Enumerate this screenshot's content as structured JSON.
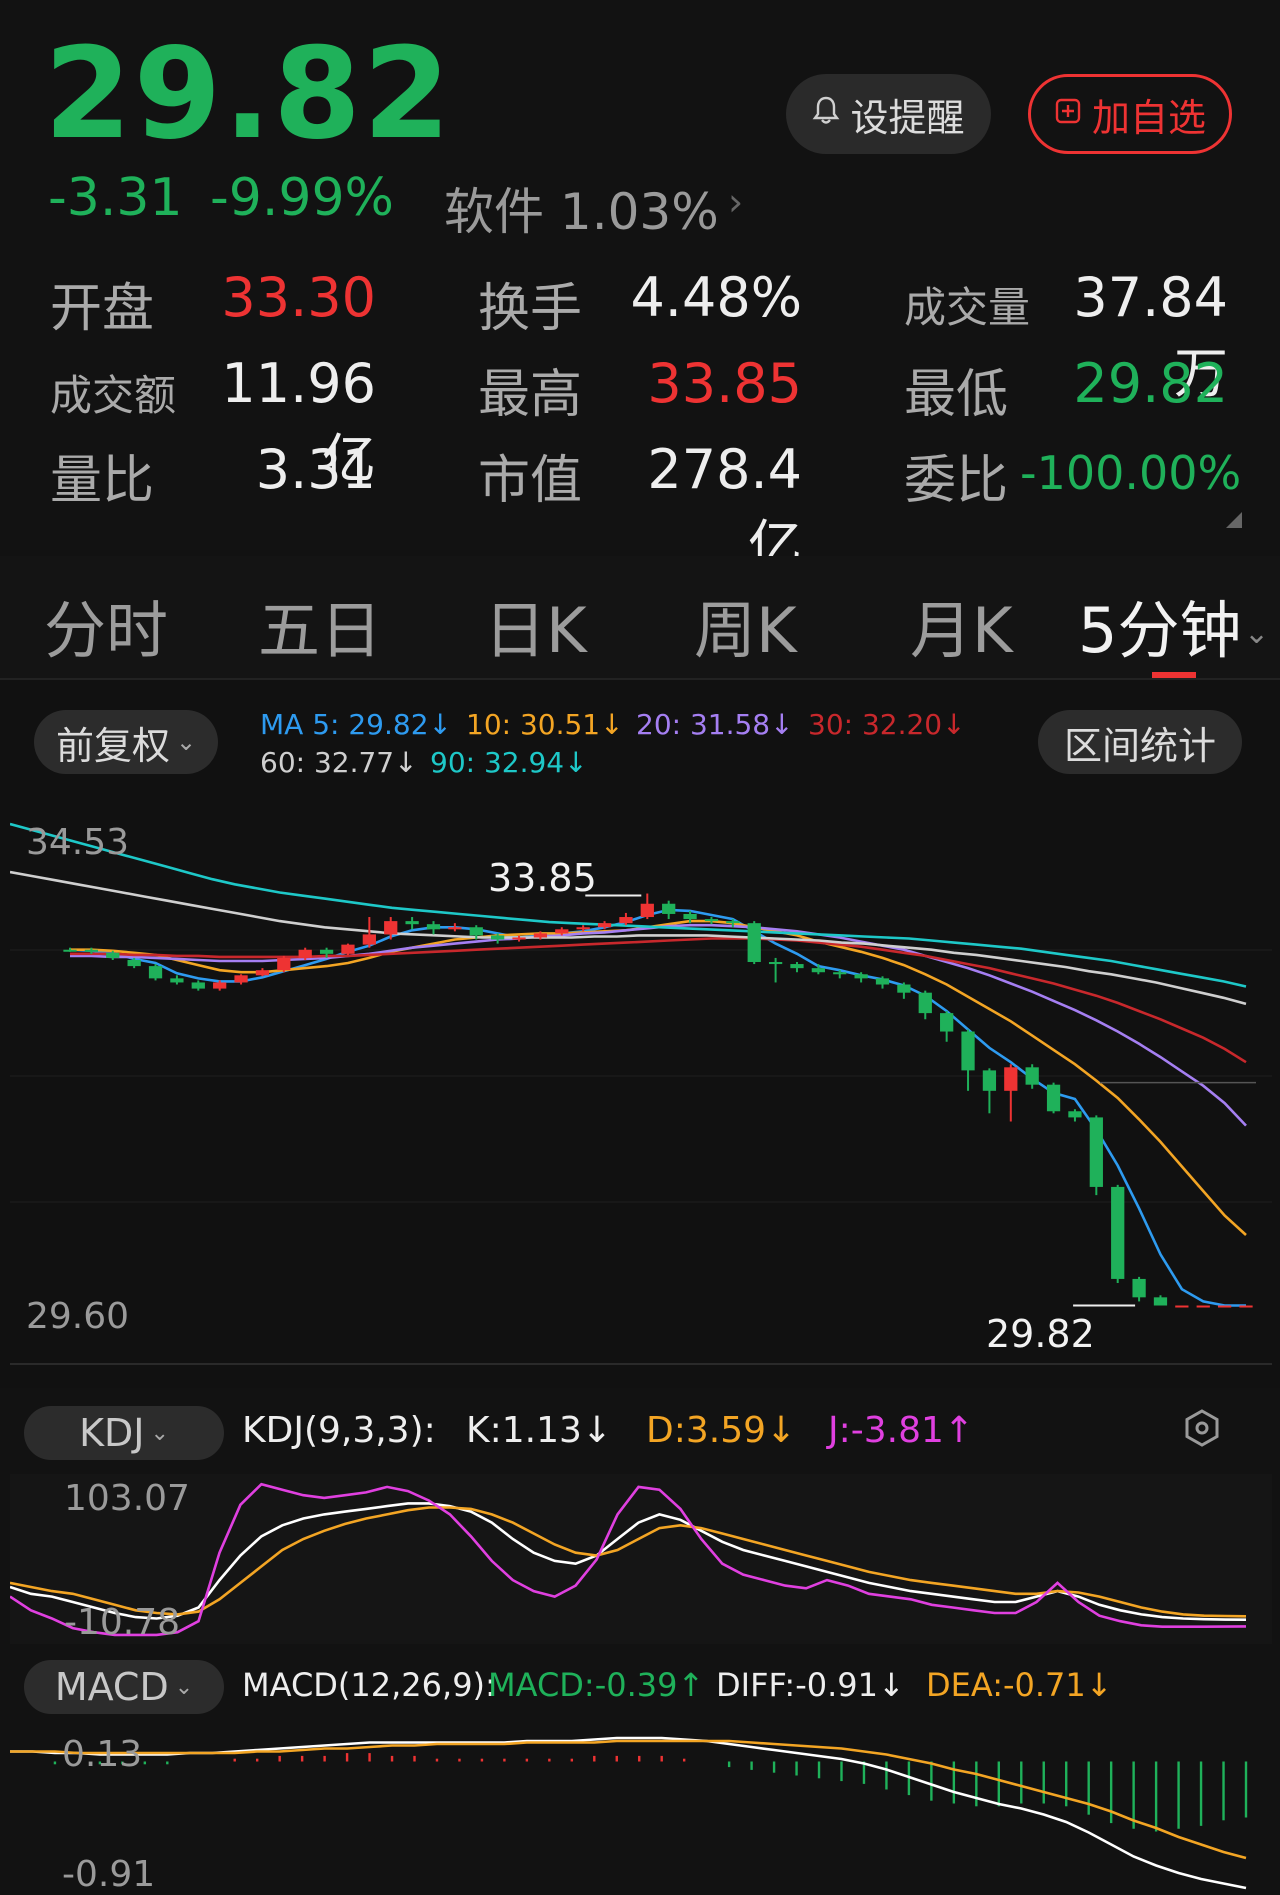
{
  "quote": {
    "price": "29.82",
    "change": "-3.31",
    "change_pct": "-9.99%",
    "sector": "软件 1.03%",
    "alert_label": "设提醒",
    "fav_label": "加自选",
    "stats": {
      "open_label": "开盘",
      "open": "33.30",
      "turnover_label": "换手",
      "turnover": "4.48%",
      "volume_label": "成交量",
      "volume": "37.84万",
      "amount_label": "成交额",
      "amount": "11.96亿",
      "high_label": "最高",
      "high": "33.85",
      "low_label": "最低",
      "low": "29.82",
      "vol_ratio_label": "量比",
      "vol_ratio": "3.31",
      "mcap_label": "市值",
      "mcap": "278.4亿",
      "bid_ratio_label": "委比",
      "bid_ratio": "-100.00%"
    },
    "colors": {
      "up": "#ee3333",
      "down": "#1fb15a"
    }
  },
  "tabs": [
    "分时",
    "五日",
    "日K",
    "周K",
    "月K",
    "5分钟"
  ],
  "active_tab": "5分钟",
  "chart": {
    "adjust_label": "前复权",
    "range_stats_label": "区间统计",
    "ma": {
      "ma5": "MA 5: 29.82↓",
      "ma10": "10: 30.51↓",
      "ma20": "20: 31.58↓",
      "ma30": "30: 32.20↓",
      "ma60": "60: 32.77↓",
      "ma90": "90: 32.94↓"
    },
    "axis_high": "34.53",
    "axis_low": "29.60",
    "max_label": "33.85",
    "min_label": "29.82"
  },
  "kdj": {
    "label": "KDJ",
    "params": "KDJ(9,3,3):",
    "k": "K:1.13↓",
    "d": "D:3.59↓",
    "j": "J:-3.81↑",
    "axis_high": "103.07",
    "axis_low": "-10.78"
  },
  "macd": {
    "label": "MACD",
    "params": "MACD(12,26,9):",
    "macd": "MACD:-0.39↑",
    "diff": "DIFF:-0.91↓",
    "dea": "DEA:-0.71↓",
    "axis_high": "0.13",
    "axis_low": "-0.91"
  },
  "chart_data": [
    {
      "type": "candlestick",
      "title": "5分钟",
      "ylim": [
        29.6,
        34.53
      ],
      "candles": [
        [
          33.3,
          33.3,
          33.32,
          33.28
        ],
        [
          33.3,
          33.28,
          33.32,
          33.26
        ],
        [
          33.27,
          33.22,
          33.29,
          33.2
        ],
        [
          33.2,
          33.14,
          33.22,
          33.12
        ],
        [
          33.14,
          33.02,
          33.16,
          33.0
        ],
        [
          33.02,
          32.98,
          33.05,
          32.96
        ],
        [
          32.98,
          32.92,
          33.0,
          32.9
        ],
        [
          32.92,
          32.98,
          33.0,
          32.9
        ],
        [
          32.98,
          33.05,
          33.06,
          32.96
        ],
        [
          33.05,
          33.1,
          33.12,
          33.04
        ],
        [
          33.1,
          33.22,
          33.24,
          33.08
        ],
        [
          33.22,
          33.3,
          33.32,
          33.2
        ],
        [
          33.3,
          33.26,
          33.32,
          33.22
        ],
        [
          33.26,
          33.35,
          33.36,
          33.25
        ],
        [
          33.35,
          33.45,
          33.62,
          33.32
        ],
        [
          33.45,
          33.58,
          33.62,
          33.4
        ],
        [
          33.58,
          33.55,
          33.62,
          33.5
        ],
        [
          33.55,
          33.5,
          33.58,
          33.45
        ],
        [
          33.5,
          33.52,
          33.56,
          33.48
        ],
        [
          33.52,
          33.44,
          33.54,
          33.4
        ],
        [
          33.44,
          33.4,
          33.46,
          33.36
        ],
        [
          33.4,
          33.42,
          33.44,
          33.38
        ],
        [
          33.42,
          33.46,
          33.48,
          33.4
        ],
        [
          33.46,
          33.5,
          33.52,
          33.44
        ],
        [
          33.5,
          33.52,
          33.54,
          33.48
        ],
        [
          33.52,
          33.56,
          33.58,
          33.5
        ],
        [
          33.56,
          33.62,
          33.66,
          33.54
        ],
        [
          33.62,
          33.75,
          33.85,
          33.6
        ],
        [
          33.75,
          33.65,
          33.78,
          33.6
        ],
        [
          33.65,
          33.6,
          33.68,
          33.56
        ],
        [
          33.6,
          33.58,
          33.62,
          33.55
        ],
        [
          33.58,
          33.56,
          33.6,
          33.52
        ],
        [
          33.56,
          33.18,
          33.58,
          33.16
        ],
        [
          33.18,
          33.16,
          33.22,
          32.98
        ],
        [
          33.16,
          33.12,
          33.18,
          33.08
        ],
        [
          33.12,
          33.08,
          33.16,
          33.06
        ],
        [
          33.08,
          33.06,
          33.1,
          33.02
        ],
        [
          33.06,
          33.02,
          33.08,
          32.98
        ],
        [
          33.02,
          32.96,
          33.04,
          32.92
        ],
        [
          32.96,
          32.88,
          32.98,
          32.82
        ],
        [
          32.88,
          32.68,
          32.9,
          32.62
        ],
        [
          32.68,
          32.5,
          32.7,
          32.4
        ],
        [
          32.5,
          32.12,
          32.52,
          31.92
        ],
        [
          32.12,
          31.92,
          32.14,
          31.7
        ],
        [
          31.92,
          32.15,
          32.18,
          31.62
        ],
        [
          32.15,
          31.98,
          32.18,
          31.94
        ],
        [
          31.98,
          31.72,
          32.0,
          31.7
        ],
        [
          31.72,
          31.66,
          31.74,
          31.62
        ],
        [
          31.66,
          30.98,
          31.68,
          30.9
        ],
        [
          30.98,
          30.08,
          31.0,
          30.04
        ],
        [
          30.08,
          29.9,
          30.1,
          29.86
        ],
        [
          29.9,
          29.82,
          29.92,
          29.82
        ],
        [
          29.82,
          29.82,
          29.82,
          29.82
        ],
        [
          29.82,
          29.82,
          29.82,
          29.82
        ],
        [
          29.82,
          29.82,
          29.82,
          29.82
        ],
        [
          29.82,
          29.82,
          29.82,
          29.82
        ]
      ],
      "candle_format": "[open, close, high, low]",
      "series": [
        {
          "name": "MA 5",
          "color": "#2e9bf0",
          "values": [
            33.3,
            33.29,
            33.27,
            33.21,
            33.17,
            33.07,
            33.02,
            32.99,
            32.99,
            33.03,
            33.09,
            33.15,
            33.21,
            33.28,
            33.34,
            33.43,
            33.49,
            33.52,
            33.52,
            33.5,
            33.46,
            33.42,
            33.44,
            33.46,
            33.48,
            33.52,
            33.57,
            33.64,
            33.69,
            33.68,
            33.64,
            33.6,
            33.48,
            33.36,
            33.26,
            33.14,
            33.1,
            33.05,
            33.01,
            32.95,
            32.85,
            32.7,
            32.52,
            32.34,
            32.2,
            32.04,
            31.9,
            31.84,
            31.54,
            31.19,
            30.77,
            30.32,
            29.98,
            29.86,
            29.82,
            29.82
          ]
        },
        {
          "name": "10",
          "color": "#f3a524",
          "values": [
            33.3,
            33.3,
            33.29,
            33.27,
            33.25,
            33.2,
            33.15,
            33.1,
            33.08,
            33.08,
            33.1,
            33.12,
            33.14,
            33.17,
            33.22,
            33.28,
            33.32,
            33.36,
            33.4,
            33.42,
            33.44,
            33.45,
            33.46,
            33.46,
            33.47,
            33.48,
            33.49,
            33.52,
            33.55,
            33.58,
            33.58,
            33.56,
            33.52,
            33.48,
            33.44,
            33.38,
            33.33,
            33.28,
            33.22,
            33.15,
            33.06,
            32.96,
            32.84,
            32.72,
            32.6,
            32.46,
            32.32,
            32.18,
            32.02,
            31.85,
            31.64,
            31.42,
            31.18,
            30.94,
            30.7,
            30.51
          ]
        },
        {
          "name": "20",
          "color": "#a57ff2",
          "values": [
            33.24,
            33.24,
            33.23,
            33.23,
            33.22,
            33.21,
            33.2,
            33.19,
            33.19,
            33.19,
            33.2,
            33.21,
            33.22,
            33.24,
            33.26,
            33.29,
            33.32,
            33.34,
            33.36,
            33.38,
            33.4,
            33.41,
            33.43,
            33.44,
            33.46,
            33.47,
            33.49,
            33.51,
            33.53,
            33.54,
            33.54,
            33.53,
            33.52,
            33.5,
            33.48,
            33.45,
            33.42,
            33.38,
            33.34,
            33.3,
            33.24,
            33.18,
            33.12,
            33.05,
            32.97,
            32.89,
            32.8,
            32.71,
            32.61,
            32.5,
            32.38,
            32.25,
            32.11,
            31.97,
            31.8,
            31.58
          ]
        },
        {
          "name": "30",
          "color": "#c8282c",
          "values": [
            33.26,
            33.26,
            33.26,
            33.25,
            33.25,
            33.24,
            33.24,
            33.23,
            33.23,
            33.23,
            33.23,
            33.23,
            33.24,
            33.24,
            33.25,
            33.26,
            33.27,
            33.28,
            33.29,
            33.3,
            33.31,
            33.32,
            33.33,
            33.34,
            33.35,
            33.36,
            33.37,
            33.38,
            33.39,
            33.4,
            33.41,
            33.41,
            33.41,
            33.4,
            33.39,
            33.37,
            33.35,
            33.33,
            33.3,
            33.27,
            33.24,
            33.2,
            33.16,
            33.12,
            33.07,
            33.02,
            32.97,
            32.91,
            32.85,
            32.78,
            32.7,
            32.62,
            32.53,
            32.44,
            32.33,
            32.2
          ]
        },
        {
          "name": "60",
          "color": "#cfcfcf",
          "values": [
            34.06,
            34.02,
            33.98,
            33.94,
            33.9,
            33.86,
            33.82,
            33.78,
            33.74,
            33.7,
            33.66,
            33.62,
            33.58,
            33.55,
            33.52,
            33.5,
            33.48,
            33.46,
            33.45,
            33.44,
            33.43,
            33.42,
            33.42,
            33.42,
            33.42,
            33.42,
            33.43,
            33.43,
            33.44,
            33.44,
            33.44,
            33.44,
            33.43,
            33.42,
            33.41,
            33.4,
            33.39,
            33.37,
            33.36,
            33.34,
            33.32,
            33.3,
            33.27,
            33.25,
            33.22,
            33.19,
            33.16,
            33.13,
            33.09,
            33.06,
            33.02,
            32.98,
            32.93,
            32.88,
            32.83,
            32.77
          ]
        },
        {
          "name": "90",
          "color": "#1ec8c8",
          "values": [
            34.53,
            34.47,
            34.41,
            34.35,
            34.29,
            34.23,
            34.17,
            34.11,
            34.05,
            33.99,
            33.94,
            33.9,
            33.86,
            33.83,
            33.8,
            33.77,
            33.74,
            33.71,
            33.69,
            33.67,
            33.65,
            33.63,
            33.61,
            33.59,
            33.57,
            33.56,
            33.55,
            33.54,
            33.53,
            33.52,
            33.51,
            33.5,
            33.49,
            33.48,
            33.47,
            33.46,
            33.45,
            33.44,
            33.43,
            33.42,
            33.41,
            33.39,
            33.37,
            33.35,
            33.33,
            33.31,
            33.28,
            33.25,
            33.22,
            33.19,
            33.15,
            33.11,
            33.07,
            33.03,
            32.99,
            32.94
          ]
        }
      ]
    },
    {
      "type": "line",
      "title": "KDJ(9,3,3)",
      "ylim": [
        -10.78,
        103.07
      ],
      "series": [
        {
          "name": "K",
          "color": "#ffffff",
          "values": [
            25,
            20,
            18,
            14,
            10,
            6,
            3,
            2,
            4,
            10,
            30,
            48,
            62,
            70,
            75,
            78,
            80,
            82,
            84,
            86,
            86,
            84,
            80,
            72,
            60,
            50,
            44,
            42,
            48,
            60,
            72,
            78,
            74,
            66,
            58,
            52,
            48,
            44,
            40,
            36,
            32,
            28,
            25,
            22,
            20,
            18,
            16,
            14,
            14,
            18,
            22,
            18,
            12,
            8,
            5,
            3,
            2,
            1.5,
            1.2,
            1.13
          ]
        },
        {
          "name": "D",
          "color": "#f3a524",
          "values": [
            28,
            25,
            22,
            20,
            16,
            12,
            8,
            6,
            5,
            7,
            16,
            28,
            40,
            52,
            60,
            66,
            71,
            75,
            78,
            81,
            83,
            83,
            82,
            78,
            72,
            64,
            56,
            50,
            48,
            52,
            60,
            68,
            70,
            68,
            64,
            60,
            56,
            52,
            48,
            44,
            40,
            36,
            33,
            30,
            28,
            26,
            24,
            22,
            20,
            20,
            22,
            21,
            18,
            14,
            10,
            7,
            5,
            4,
            3.8,
            3.59
          ]
        },
        {
          "name": "J",
          "color": "#e040e0",
          "values": [
            18,
            8,
            2,
            -5,
            -8,
            -10,
            -10,
            -10,
            -8,
            0,
            50,
            85,
            100,
            96,
            92,
            90,
            92,
            94,
            98,
            95,
            88,
            78,
            62,
            44,
            30,
            22,
            18,
            26,
            45,
            78,
            98,
            96,
            82,
            60,
            42,
            34,
            30,
            26,
            24,
            30,
            26,
            20,
            18,
            16,
            12,
            10,
            8,
            6,
            6,
            14,
            28,
            14,
            4,
            0,
            -3,
            -4,
            -4,
            -4,
            -3.9,
            -3.81
          ]
        }
      ]
    },
    {
      "type": "bar",
      "title": "MACD(12,26,9)",
      "ylim": [
        -0.91,
        0.13
      ],
      "series": [
        {
          "name": "DIFF",
          "color": "#ffffff",
          "values": [
            0.0,
            0.0,
            -0.01,
            -0.01,
            -0.02,
            -0.02,
            -0.02,
            -0.02,
            -0.01,
            -0.01,
            0.0,
            0.01,
            0.02,
            0.03,
            0.04,
            0.05,
            0.06,
            0.06,
            0.06,
            0.06,
            0.06,
            0.06,
            0.06,
            0.07,
            0.07,
            0.07,
            0.08,
            0.09,
            0.09,
            0.09,
            0.08,
            0.07,
            0.05,
            0.03,
            0.01,
            -0.01,
            -0.03,
            -0.05,
            -0.08,
            -0.12,
            -0.17,
            -0.22,
            -0.27,
            -0.31,
            -0.35,
            -0.38,
            -0.42,
            -0.47,
            -0.54,
            -0.62,
            -0.7,
            -0.76,
            -0.81,
            -0.85,
            -0.88,
            -0.91
          ]
        },
        {
          "name": "DEA",
          "color": "#f3a524",
          "values": [
            0.0,
            0.0,
            0.0,
            -0.01,
            -0.01,
            -0.01,
            -0.01,
            -0.01,
            -0.01,
            -0.01,
            -0.01,
            0.0,
            0.0,
            0.01,
            0.02,
            0.02,
            0.03,
            0.04,
            0.04,
            0.05,
            0.05,
            0.05,
            0.05,
            0.06,
            0.06,
            0.06,
            0.06,
            0.07,
            0.07,
            0.07,
            0.07,
            0.07,
            0.07,
            0.06,
            0.05,
            0.04,
            0.03,
            0.02,
            0.0,
            -0.02,
            -0.05,
            -0.08,
            -0.12,
            -0.15,
            -0.19,
            -0.23,
            -0.27,
            -0.31,
            -0.35,
            -0.4,
            -0.46,
            -0.51,
            -0.57,
            -0.62,
            -0.67,
            -0.71
          ]
        }
      ]
    }
  ]
}
